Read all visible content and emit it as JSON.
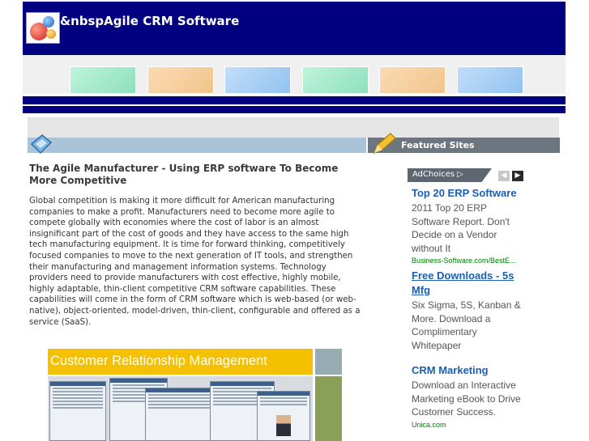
{
  "header": {
    "site_title": "&nbspAgile CRM Software"
  },
  "colors": {
    "header_navy": "#000080",
    "tab_colors": [
      "#a8e8cc",
      "#f5cfa0",
      "#a9d0f5",
      "#a8e8cc",
      "#f5cfa0",
      "#a9d0f5"
    ]
  },
  "sidebar": {
    "featured_title": "Featured Sites"
  },
  "article": {
    "title": "The Agile Manufacturer - Using ERP software To Become More Competitive",
    "body": "Global competition is making it more difficult for American manufacturing companies to make a profit. Manufacturers need to become more agile to compete globally with economies where the cost of labor is an almost insignificant part of the cost of goods and they have access to the same high tech manufacturing equipment. It is time for forward thinking, competitively focused companies to move to the next generation of IT tools, and strengthen their manufacturing and management information systems. Technology providers need to provide manufacturers with cost effective, highly mobile, highly adaptable, thin-client competitive CRM software capabilities. These capabilities will come in the form of CRM software which is web-based (or web-native), object-oriented, model-driven, thin-client, configurable and offered as a service (SaaS).",
    "banner_text": "Customer Relationship Management"
  },
  "ads": {
    "adchoices_label": "AdChoices ▷",
    "prev_label": "◀",
    "next_label": "▶",
    "items": [
      {
        "headline": "Top 20 ERP Software",
        "text": "2011 Top 20 ERP Software Report. Don't Decide on a Vendor without It",
        "url": "Business-Software.com/BestE..."
      },
      {
        "headline": "Free Downloads - 5s Mfg",
        "text": "Six Sigma, 5S, Kanban & More. Download a Complimentary Whitepaper",
        "url": ""
      },
      {
        "headline": "CRM Marketing",
        "text": "Download an Interactive Marketing eBook to Drive Customer Success.",
        "url": "Unica.com"
      }
    ]
  }
}
